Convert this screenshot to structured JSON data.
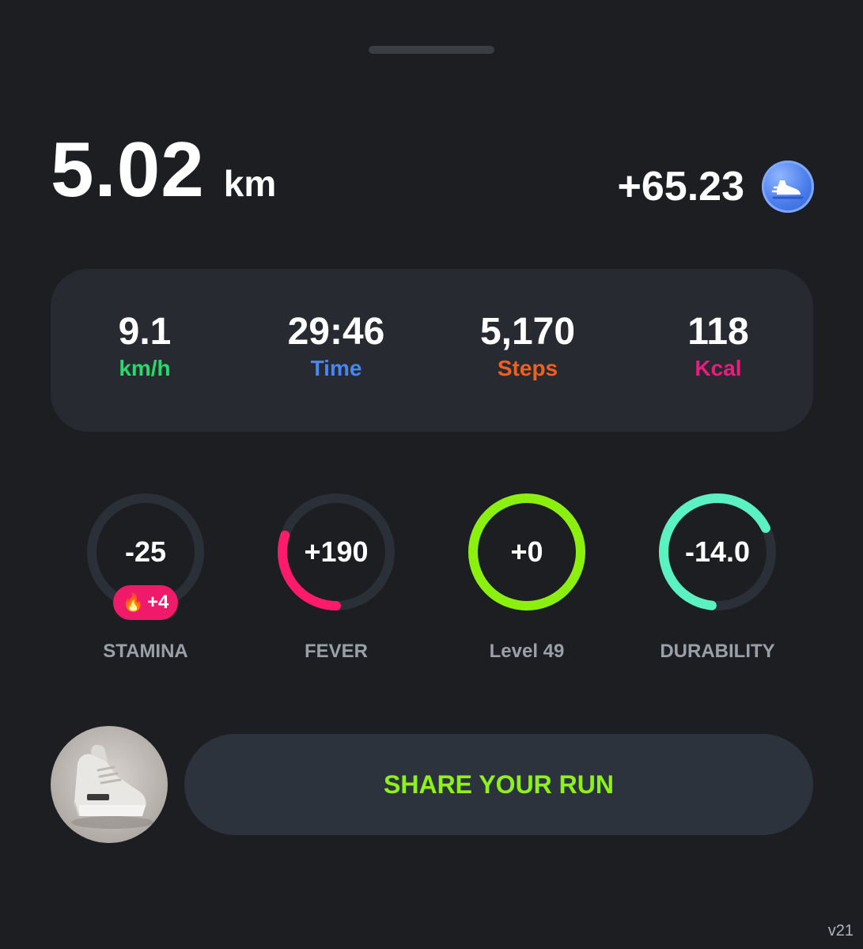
{
  "run": {
    "distance": "5.02",
    "distance_unit": "km",
    "reward": "+65.23",
    "token_icon": "sneaker-token-icon"
  },
  "stats": [
    {
      "value": "9.1",
      "label": "km/h",
      "color": "#29d96b"
    },
    {
      "value": "29:46",
      "label": "Time",
      "color": "#4a86f0"
    },
    {
      "value": "5,170",
      "label": "Steps",
      "color": "#f0601e"
    },
    {
      "value": "118",
      "label": "Kcal",
      "color": "#ec1b7e"
    }
  ],
  "gauges": [
    {
      "value": "-25",
      "label": "STAMINA",
      "color": "#2b3038",
      "progress": 0
    },
    {
      "value": "+190",
      "label": "FEVER",
      "color": "#ff1a6a",
      "progress": 0.3
    },
    {
      "value": "+0",
      "label": "Level 49",
      "color": "#8cf00f",
      "progress": 1.0
    },
    {
      "value": "-14.0",
      "label": "DURABILITY",
      "color": "#5cf1c0",
      "progress": 0.66
    }
  ],
  "stamina_badge": {
    "icon": "fire-icon",
    "value": "+4"
  },
  "share_button": "SHARE YOUR RUN",
  "version": "v21",
  "colors": {
    "background": "#1c1e22",
    "card": "#272b31",
    "track": "#2b3038",
    "accent": "#8cf21a"
  }
}
